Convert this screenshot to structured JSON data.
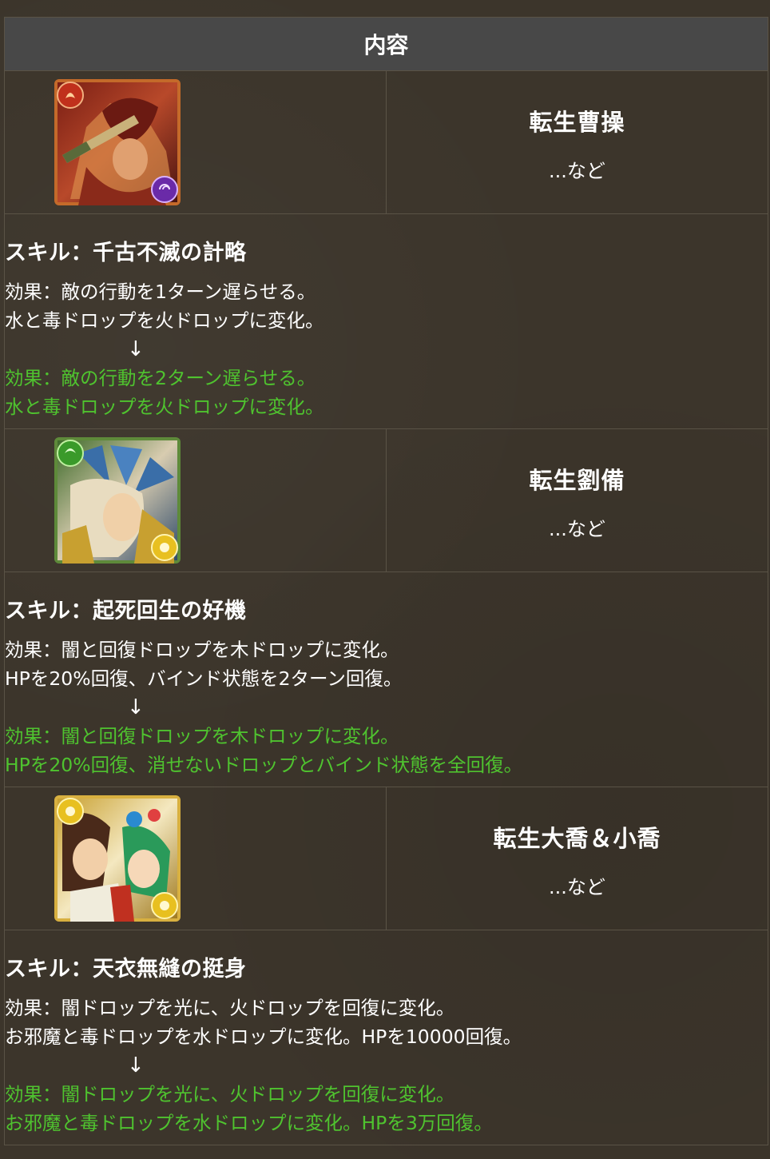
{
  "header": {
    "title": "内容"
  },
  "monsters": [
    {
      "name": "転生曹操",
      "etc": "...など",
      "icon": "cao-cao-card-icon",
      "skill_title": "スキル：千古不滅の計略",
      "before": [
        "効果：敵の行動を1ターン遅らせる。",
        "水と毒ドロップを火ドロップに変化。"
      ],
      "arrow": "↓",
      "after": [
        "効果：敵の行動を2ターン遅らせる。",
        "水と毒ドロップを火ドロップに変化。"
      ]
    },
    {
      "name": "転生劉備",
      "etc": "...など",
      "icon": "liu-bei-card-icon",
      "skill_title": "スキル：起死回生の好機",
      "before": [
        "効果：闇と回復ドロップを木ドロップに変化。",
        "HPを20%回復、バインド状態を2ターン回復。"
      ],
      "arrow": "↓",
      "after": [
        "効果：闇と回復ドロップを木ドロップに変化。",
        "HPを20%回復、消せないドロップとバインド状態を全回復。"
      ]
    },
    {
      "name": "転生大喬＆小喬",
      "etc": "...など",
      "icon": "daqiao-xiaoqiao-card-icon",
      "skill_title": "スキル：天衣無縫の挺身",
      "before": [
        "効果：闇ドロップを光に、火ドロップを回復に変化。",
        "お邪魔と毒ドロップを水ドロップに変化。HPを10000回復。"
      ],
      "arrow": "↓",
      "after": [
        "効果：闇ドロップを光に、火ドロップを回復に変化。",
        "お邪魔と毒ドロップを水ドロップに変化。HPを3万回復。"
      ]
    }
  ],
  "colors": {
    "background": "#3c352b",
    "header_bg": "#484848",
    "text": "#ffffff",
    "highlight": "#4fc32f",
    "border": "#5a5346"
  }
}
